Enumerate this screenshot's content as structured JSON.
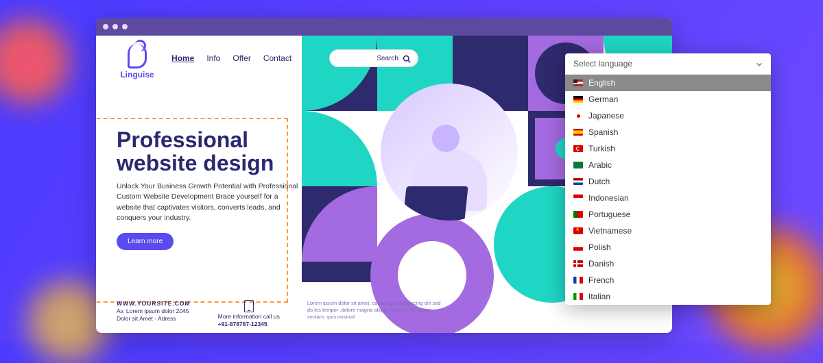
{
  "brand": {
    "name": "Linguise"
  },
  "nav": {
    "items": [
      "Home",
      "Info",
      "Offer",
      "Contact"
    ],
    "active_index": 0
  },
  "search": {
    "placeholder": "Search"
  },
  "hero": {
    "title": "Professional website design",
    "body": "Unlock Your Business Growth Potential with Professional Custom Website Development Brace yourself for a website that captivates visitors, converts leads, and conquers your industry.",
    "cta": "Learn more"
  },
  "footer": {
    "site_url": "WWW.YOURSITE.COM",
    "address_line1": "Av. Lorem ipsum dolor 2045",
    "address_line2": "Dolor sit Amet - Adress",
    "phone_label": "More information call us",
    "phone_number": "+91-878787-12345",
    "lorem": "Lorem ipsum dolor sit amet, consectetur adipiscing elit sed do les tempor .dolore magna aliqua. Ut enim ad minim veniam, quis nostrud"
  },
  "language_selector": {
    "label": "Select language",
    "selected_index": 0,
    "options": [
      {
        "label": "English",
        "flag": "us"
      },
      {
        "label": "German",
        "flag": "de"
      },
      {
        "label": "Japanese",
        "flag": "jp"
      },
      {
        "label": "Spanish",
        "flag": "es"
      },
      {
        "label": "Turkish",
        "flag": "tr"
      },
      {
        "label": "Arabic",
        "flag": "sa"
      },
      {
        "label": "Dutch",
        "flag": "nl"
      },
      {
        "label": "Indonesian",
        "flag": "id"
      },
      {
        "label": "Portuguese",
        "flag": "pt"
      },
      {
        "label": "Vietnamese",
        "flag": "vn"
      },
      {
        "label": "Polish",
        "flag": "pl"
      },
      {
        "label": "Danish",
        "flag": "dk"
      },
      {
        "label": "French",
        "flag": "fr"
      },
      {
        "label": "Italian",
        "flag": "it"
      }
    ]
  }
}
